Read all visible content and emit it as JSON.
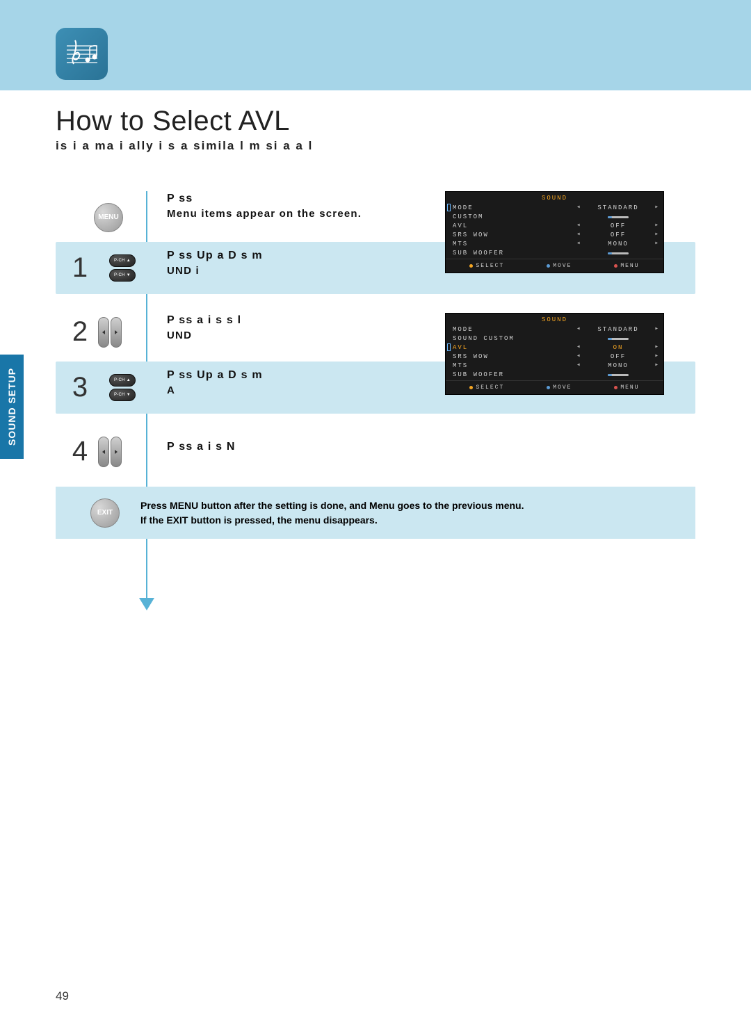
{
  "section_tab": "SOUND SETUP",
  "title": "How to Select AVL",
  "subtitle": "is    i  a  ma i ally  i  s a simila   l m  si      a     a   l",
  "page_number": "49",
  "menu_button_label": "MENU",
  "exit_button_label": "EXIT",
  "pch_up_label": "P-CH ▲",
  "pch_down_label": "P-CH ▼",
  "step0": {
    "line1": "P   ss",
    "line2": "Menu items appear on the screen."
  },
  "step1": {
    "num": "1",
    "line1": "P   ss Up a   D          s    m",
    "line2": "  UND i"
  },
  "step2": {
    "num": "2",
    "line1": "P   ss       a   i        s    s l",
    "line2": "  UND"
  },
  "step3": {
    "num": "3",
    "line1": "P   ss Up a   D          s    m",
    "line2": "A"
  },
  "step4": {
    "num": "4",
    "line1": "P   ss       a   i        s    N"
  },
  "footer": {
    "line1": "Press MENU button after the setting is done, and Menu goes to the previous menu.",
    "line2": "If the EXIT button is pressed, the menu disappears."
  },
  "osd1": {
    "title": "SOUND",
    "rows": [
      {
        "label": "MODE",
        "val": "STANDARD",
        "arrows": true
      },
      {
        "label": "CUSTOM",
        "val": "",
        "bar": true
      },
      {
        "label": "AVL",
        "val": "OFF",
        "arrows": true
      },
      {
        "label": "SRS  WOW",
        "val": "OFF",
        "arrows": true
      },
      {
        "label": "MTS",
        "val": "MONO",
        "arrows": true
      },
      {
        "label": "SUB  WOOFER",
        "val": "",
        "bar": true
      }
    ],
    "cursor_row": 0,
    "footer": [
      "SELECT",
      "MOVE",
      "MENU"
    ]
  },
  "osd2": {
    "title": "SOUND",
    "rows": [
      {
        "label": "MODE",
        "val": "STANDARD",
        "arrows": true
      },
      {
        "label": "SOUND  CUSTOM",
        "val": "",
        "bar": true
      },
      {
        "label": "AVL",
        "val": "ON",
        "arrows": true,
        "highlight": true
      },
      {
        "label": "SRS WOW",
        "val": "OFF",
        "arrows": true
      },
      {
        "label": "MTS",
        "val": "MONO",
        "arrows": true
      },
      {
        "label": "SUB  WOOFER",
        "val": "",
        "bar": true
      }
    ],
    "cursor_row": 2,
    "footer": [
      "SELECT",
      "MOVE",
      "MENU"
    ]
  }
}
